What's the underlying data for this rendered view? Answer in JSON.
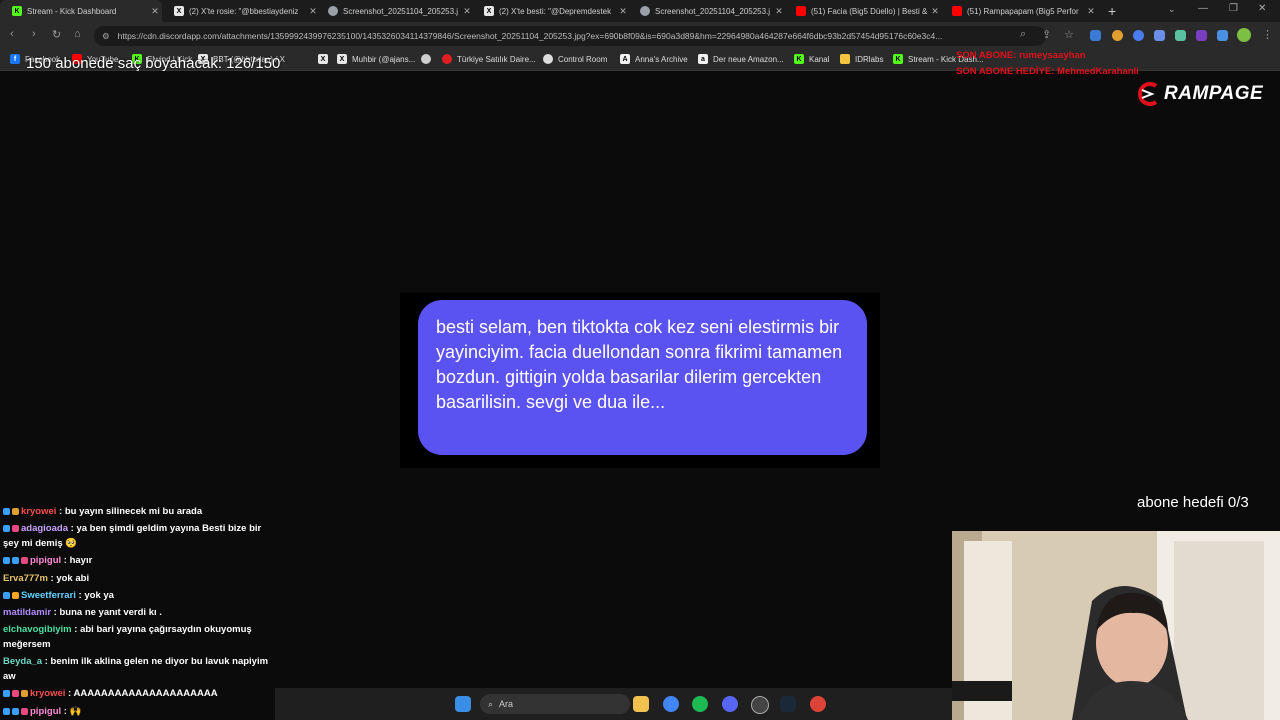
{
  "tabs": [
    {
      "title": "Stream - Kick Dashboard",
      "icon": "kick-icon"
    },
    {
      "title": "(2) X'te rosie: \"@bbestiaydeniz",
      "icon": "x-icon"
    },
    {
      "title": "Screenshot_20251104_205253.j",
      "icon": "globe-icon"
    },
    {
      "title": "(2) X'te besti: \"@Depremdestek",
      "icon": "x-icon"
    },
    {
      "title": "Screenshot_20251104_205253.j",
      "icon": "globe-icon"
    },
    {
      "title": "(51) Facia (Big5 Düello) | Besti &",
      "icon": "youtube-icon"
    },
    {
      "title": "(51) Rampapapam (Big5 Perfor",
      "icon": "youtube-icon"
    }
  ],
  "url": "https://cdn.discordapp.com/attachments/1359992439976235100/1435326034114379846/Screenshot_20251104_205253.jpg?ex=690b8f09&is=690a3d89&hm=22964980a464287e664f6dbc93b2d57454d95176c60e3c4...",
  "bookmarks": [
    {
      "label": "Facebook",
      "icon": "facebook-icon"
    },
    {
      "label": "YouTube",
      "icon": "youtube-icon"
    },
    {
      "label": "Elwind | Kick",
      "icon": "kick-icon"
    },
    {
      "label": "BBT (@bbtbrlan) / X",
      "icon": "x-icon"
    },
    {
      "label": "",
      "icon": "x-icon"
    },
    {
      "label": "Muhbir (@ajans...",
      "icon": "x-icon"
    },
    {
      "label": "",
      "icon": "globe-icon"
    },
    {
      "label": "Türkiye Satılık Daire...",
      "icon": "sahibinden-icon"
    },
    {
      "label": "Control Room",
      "icon": "gear-icon"
    },
    {
      "label": "Anna's Archive",
      "icon": "book-icon"
    },
    {
      "label": "Der neue Amazon...",
      "icon": "amazon-icon"
    },
    {
      "label": "Kanal",
      "icon": "kick-icon"
    },
    {
      "label": "IDRlabs",
      "icon": "idrlabs-icon"
    },
    {
      "label": "Stream - Kick Dash...",
      "icon": "kick-icon"
    }
  ],
  "overlay": {
    "sub_goal": "150 abonede saç boyahacak: 126/150",
    "last_sub": "SON ABONE: rumeysaayhan",
    "last_gift": "SON ABONE HEDİYE: MehmedKarahanli",
    "logo": "RAMPAGE",
    "sub_target": "abone hedefi 0/3"
  },
  "message": "besti selam, ben tiktokta cok kez seni elestirmis bir yayinciyim. facia duellondan sonra fikrimi tamamen bozdun. gittigin yolda basarilar dilerim gercekten basarilisin. sevgi ve dua ile...",
  "chat": [
    {
      "user": "kryowei",
      "text": " : bu yayın silinecek mi bu arada",
      "color": "#ff4d4d"
    },
    {
      "user": "adagioada",
      "text": " : ya ben şimdi geldim yayına Besti bize bir şey mi demiş 🥺",
      "color": "#c8a2ff"
    },
    {
      "user": "pipigul",
      "text": " : hayır",
      "color": "#ff8ad8"
    },
    {
      "user": "Erva777m",
      "text": " : yok abi",
      "color": "#e6c36a"
    },
    {
      "user": "Sweetferrari",
      "text": " : yok ya",
      "color": "#63d2ff"
    },
    {
      "user": "matildamir",
      "text": " : buna ne yanıt verdi kı .",
      "color": "#b38cff"
    },
    {
      "user": "elchavogibiyim",
      "text": " : abi bari yayına çağırsaydın okuyomuş meğersem",
      "color": "#4de0a0"
    },
    {
      "user": "Beyda_a",
      "text": " : benim ilk aklina gelen ne diyor bu lavuk napiyim aw",
      "color": "#6fd6c0"
    },
    {
      "user": "kryowei",
      "text": " : AAAAAAAAAAAAAAAAAAAAA",
      "color": "#ff4d4d"
    },
    {
      "user": "pipigul",
      "text": " : 🙌",
      "color": "#ff8ad8"
    }
  ],
  "taskbar": {
    "search_placeholder": "Ara",
    "apps": [
      "windows-start-icon",
      "file-explorer-icon",
      "chrome-icon",
      "spotify-icon",
      "discord-icon",
      "obs-icon",
      "steam-icon",
      "chrome-icon"
    ]
  }
}
